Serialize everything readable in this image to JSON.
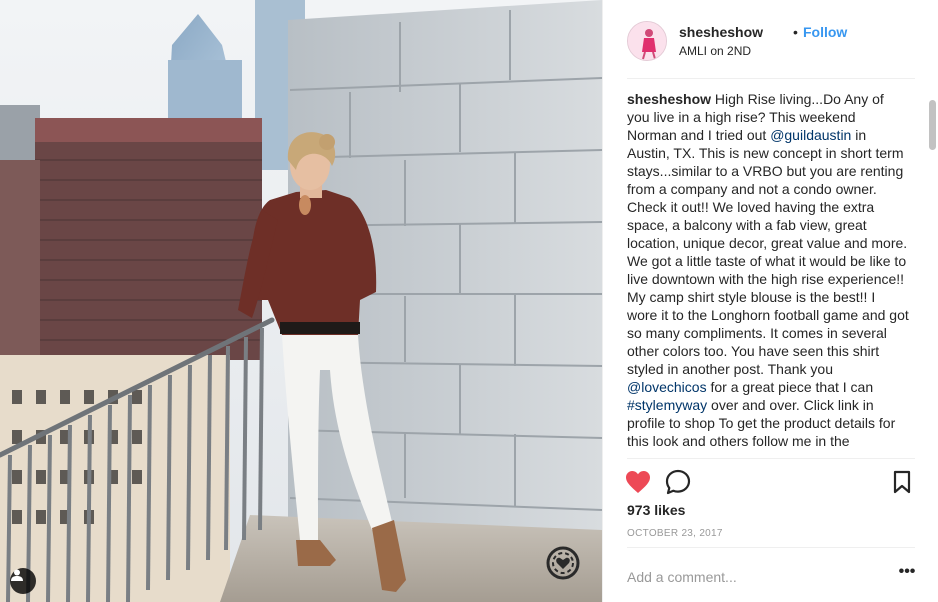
{
  "post": {
    "username": "shesheshow",
    "separator": "•",
    "follow_label": "Follow",
    "location": "AMLI on 2ND",
    "caption": {
      "segments": [
        {
          "type": "user",
          "text": "shesheshow"
        },
        {
          "type": "text",
          "text": " High Rise living...Do Any of you live in a high rise? This weekend Norman and I tried out "
        },
        {
          "type": "link",
          "text": "@guildaustin"
        },
        {
          "type": "text",
          "text": " in Austin, TX. This is new concept in short term stays...similar to a VRBO but you are renting from a company and not a condo owner. Check it out!! We loved having the extra space, a balcony with a fab view, great location, unique decor, great value and more. We got a little taste of what it would be like to live downtown with the high rise experience!! My camp shirt style blouse is the best!! I wore it to the Longhorn football game and got so many compliments. It comes in several other colors too. You have seen this shirt styled in another post. Thank you "
        },
        {
          "type": "link",
          "text": "@lovechicos"
        },
        {
          "type": "text",
          "text": " for a great piece that I can "
        },
        {
          "type": "link",
          "text": "#stylemyway"
        },
        {
          "type": "text",
          "text": " over and over. Click link in profile to shop To get the product details for this look and others follow me in the"
        }
      ]
    },
    "likes": "973 likes",
    "date": "OCTOBER 23, 2017",
    "comment_placeholder": "Add a comment...",
    "more_label": "•••"
  },
  "icons": {
    "like": "heart-icon",
    "comment": "comment-bubble-icon",
    "save": "bookmark-icon",
    "tag": "user-tag-icon",
    "watermark": "heart-badge-icon"
  },
  "colors": {
    "like": "#ed4956",
    "follow": "#3897f0",
    "link": "#003569",
    "muted": "#999999"
  }
}
